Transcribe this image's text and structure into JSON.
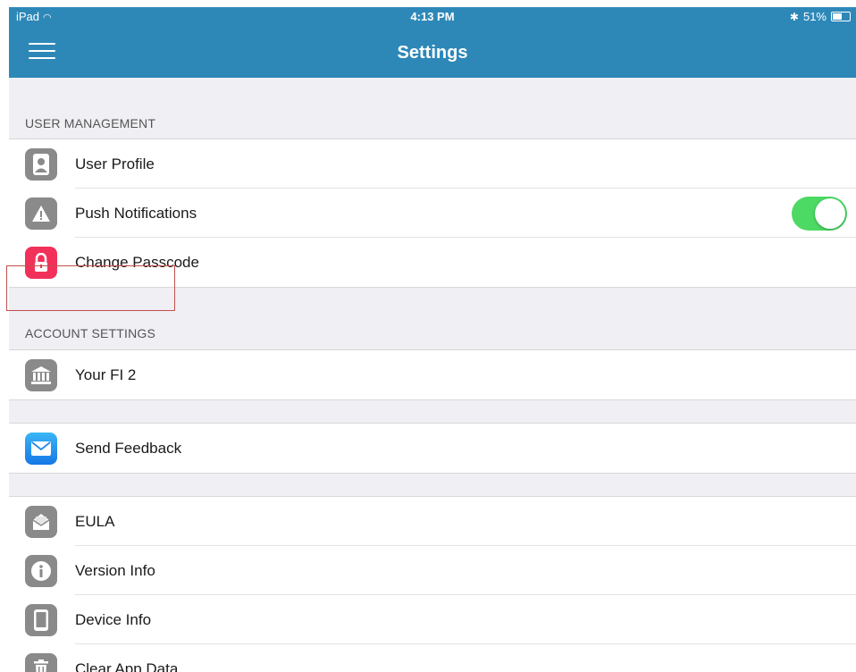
{
  "status_bar": {
    "carrier": "iPad",
    "time": "4:13 PM",
    "battery_text": "51%",
    "battery_level": 0.51
  },
  "nav": {
    "title": "Settings"
  },
  "sections": {
    "user_management": {
      "header": "USER MANAGEMENT",
      "items": [
        {
          "label": "User Profile",
          "icon": "user-icon"
        },
        {
          "label": "Push Notifications",
          "icon": "alert-icon",
          "toggle_on": true
        },
        {
          "label": "Change Passcode",
          "icon": "lock-icon"
        }
      ]
    },
    "account_settings": {
      "header": "ACCOUNT SETTINGS",
      "items": [
        {
          "label": "Your FI 2",
          "icon": "bank-icon"
        }
      ]
    },
    "feedback": {
      "items": [
        {
          "label": "Send Feedback",
          "icon": "mail-icon"
        }
      ]
    },
    "info": {
      "items": [
        {
          "label": "EULA",
          "icon": "document-icon"
        },
        {
          "label": "Version Info",
          "icon": "info-icon"
        },
        {
          "label": "Device Info",
          "icon": "device-icon"
        },
        {
          "label": "Clear App Data",
          "icon": "trash-icon"
        }
      ]
    }
  },
  "colors": {
    "header_bar": "#2d88b8",
    "toggle_on": "#4cd964",
    "passcode_icon": "#f2315a",
    "highlight": "#c0504d"
  }
}
